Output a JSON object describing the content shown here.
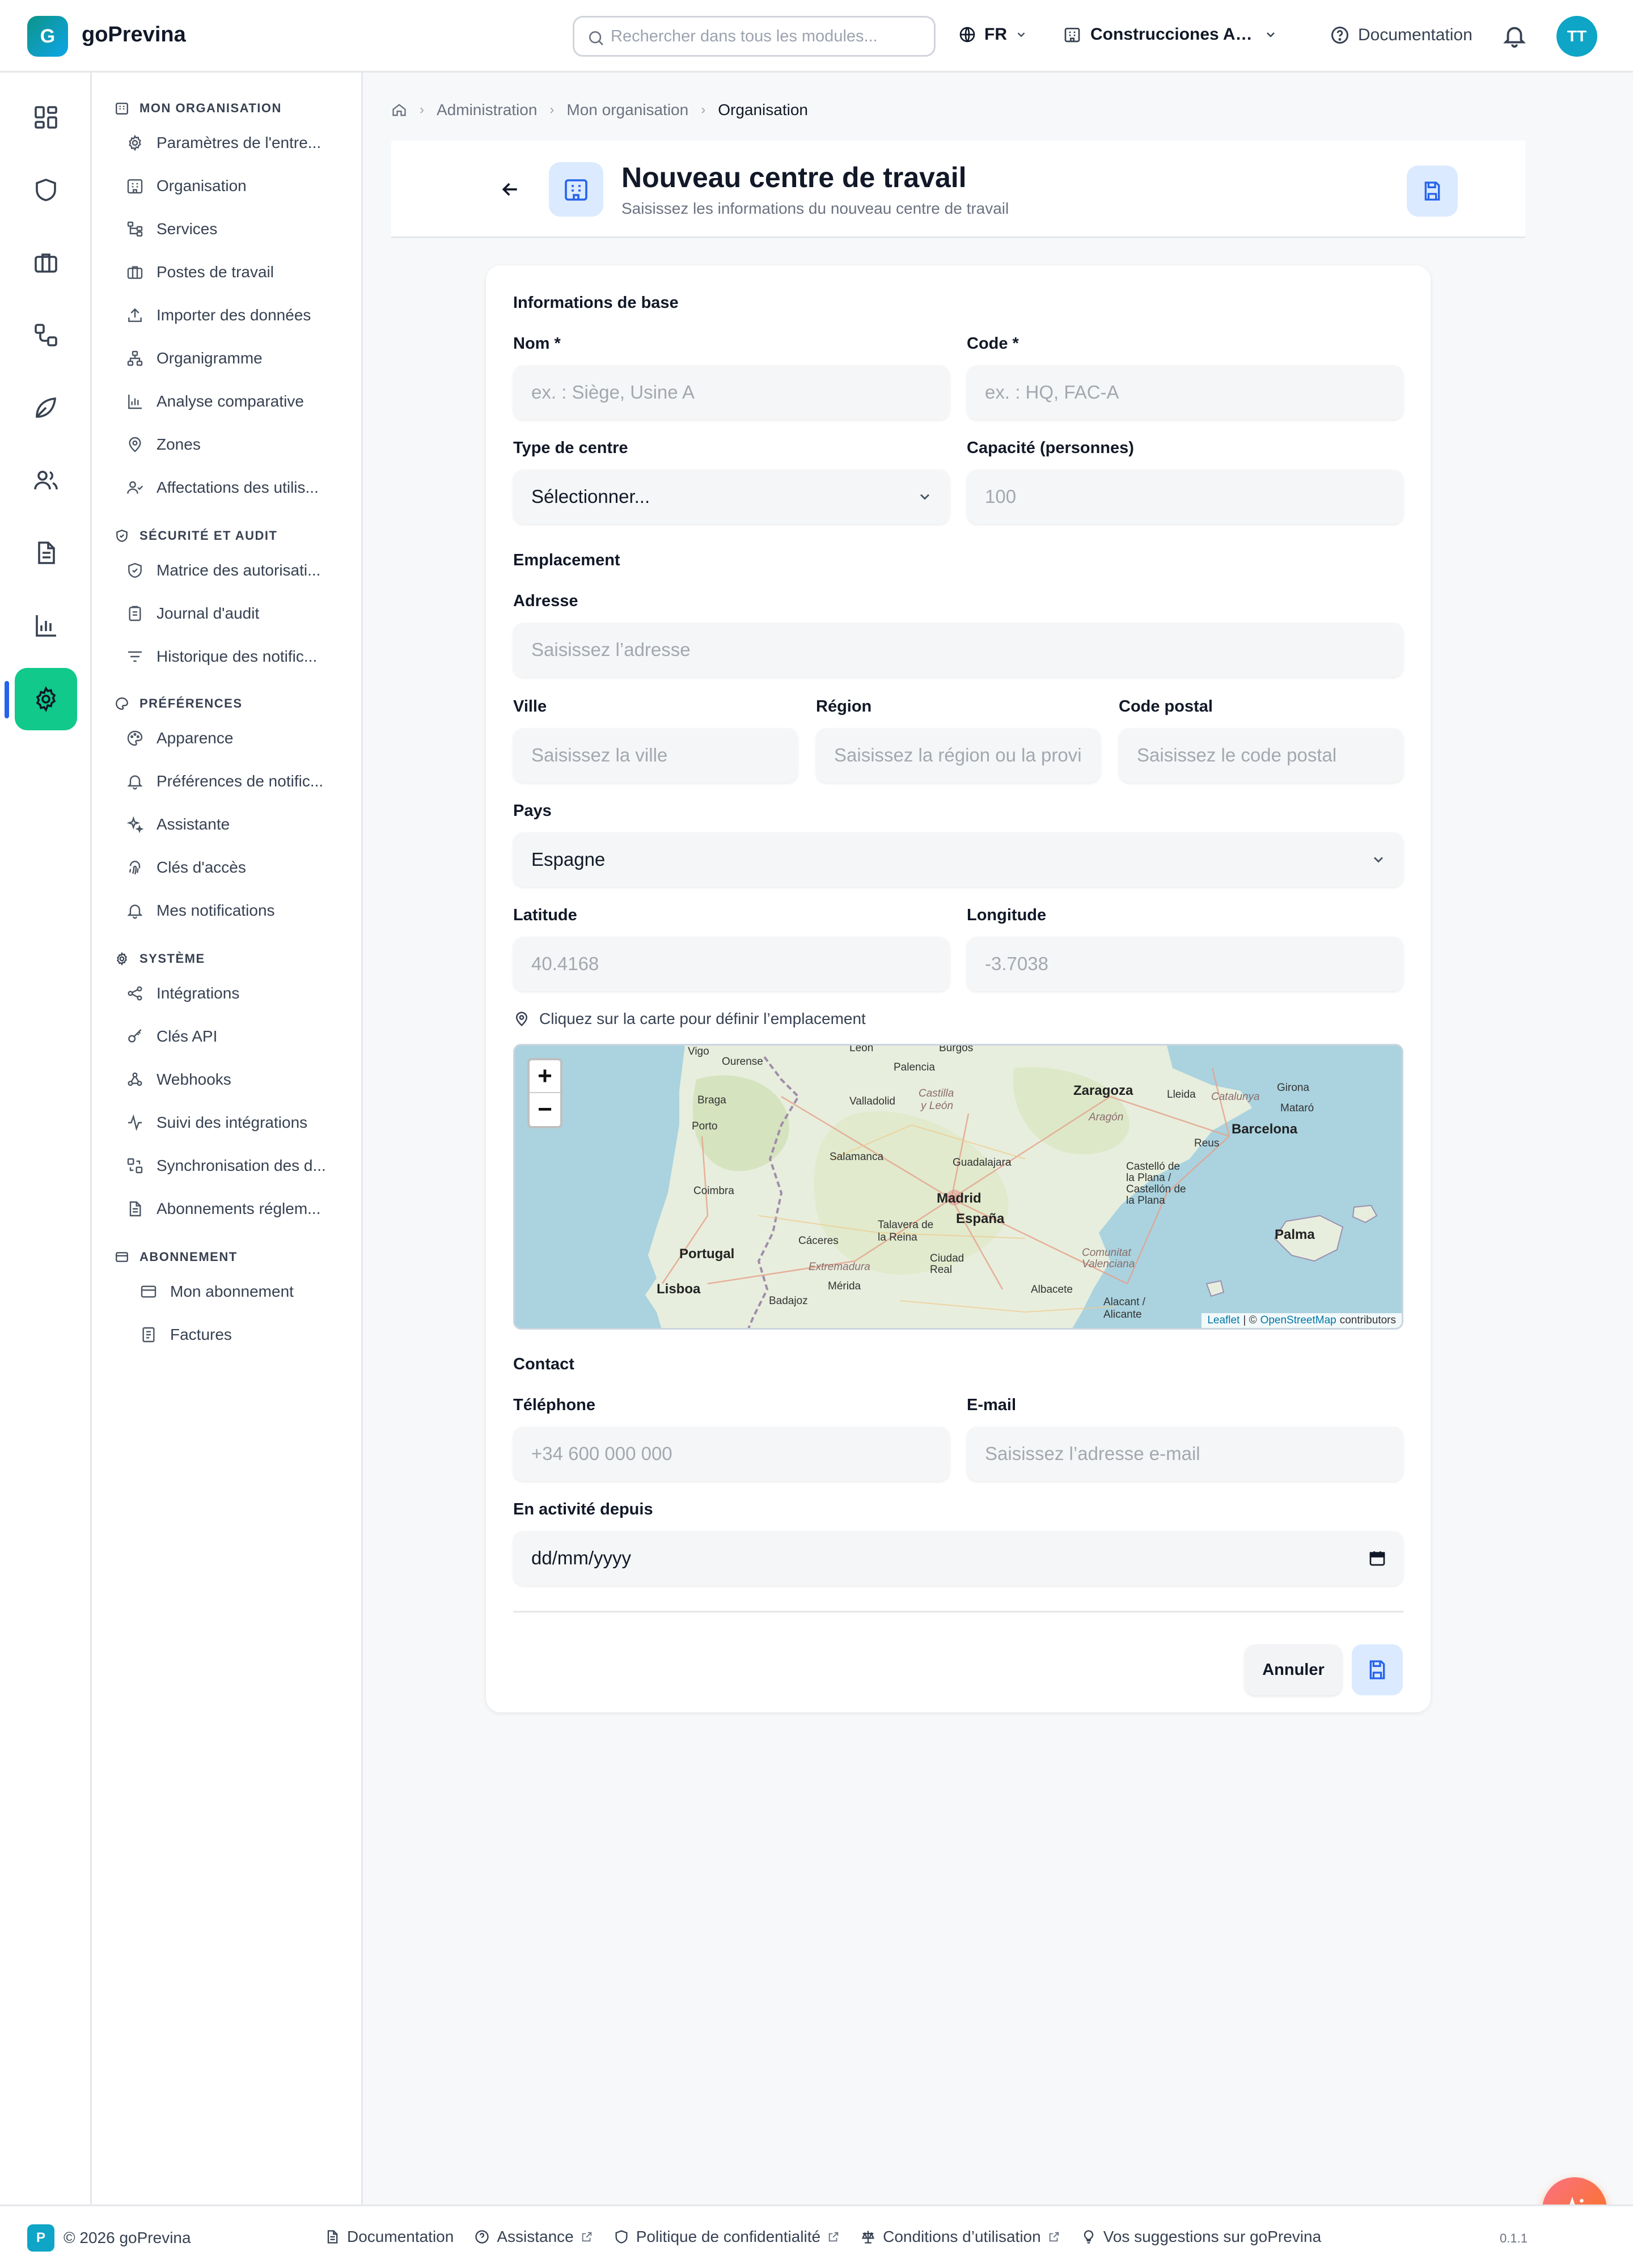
{
  "app": {
    "logo_letter": "G",
    "name": "goPrevina"
  },
  "topbar": {
    "search_placeholder": "Rechercher dans tous les modules...",
    "language": "FR",
    "tenant": "Construcciones Ac...",
    "documentation": "Documentation",
    "avatar_initials": "TT"
  },
  "rail": [
    {
      "icon": "dashboard-icon"
    },
    {
      "icon": "shield-icon"
    },
    {
      "icon": "briefcase-icon"
    },
    {
      "icon": "workflow-icon"
    },
    {
      "icon": "leaf-icon"
    },
    {
      "icon": "users-icon"
    },
    {
      "icon": "file-text-icon"
    },
    {
      "icon": "bar-chart-icon"
    },
    {
      "icon": "settings-icon",
      "active": true
    }
  ],
  "sidebar": {
    "sections": [
      {
        "title": "Mon organisation",
        "items": [
          "Paramètres de l'entre...",
          "Organisation",
          "Services",
          "Postes de travail",
          "Importer des données",
          "Organigramme",
          "Analyse comparative",
          "Zones",
          "Affectations des utilis..."
        ]
      },
      {
        "title": "Sécurité et audit",
        "items": [
          "Matrice des autorisati...",
          "Journal d'audit",
          "Historique des notific..."
        ]
      },
      {
        "title": "Préférences",
        "items": [
          "Apparence",
          "Préférences de notific...",
          "Assistante",
          "Clés d'accès",
          "Mes notifications"
        ]
      },
      {
        "title": "Système",
        "items": [
          "Intégrations",
          "Clés API",
          "Webhooks",
          "Suivi des intégrations",
          "Synchronisation des d...",
          "Abonnements réglem..."
        ]
      },
      {
        "title": "Abonnement",
        "items": [
          "Mon abonnement",
          "Factures"
        ]
      }
    ]
  },
  "breadcrumb": [
    "Administration",
    "Mon organisation",
    "Organisation"
  ],
  "header": {
    "title": "Nouveau centre de travail",
    "subtitle": "Saisissez les informations du nouveau centre de travail"
  },
  "form": {
    "basic_title": "Informations de base",
    "name_label": "Nom *",
    "name_placeholder": "ex. : Siège, Usine A",
    "code_label": "Code *",
    "code_placeholder": "ex. : HQ, FAC-A",
    "type_label": "Type de centre",
    "type_value": "Sélectionner...",
    "capacity_label": "Capacité (personnes)",
    "capacity_placeholder": "100",
    "location_title": "Emplacement",
    "address_label": "Adresse",
    "address_placeholder": "Saisissez l’adresse",
    "city_label": "Ville",
    "city_placeholder": "Saisissez la ville",
    "region_label": "Région",
    "region_placeholder": "Saisissez la région ou la province",
    "postal_label": "Code postal",
    "postal_placeholder": "Saisissez le code postal",
    "country_label": "Pays",
    "country_value": "Espagne",
    "lat_label": "Latitude",
    "lat_placeholder": "40.4168",
    "lng_label": "Longitude",
    "lng_placeholder": "-3.7038",
    "map_hint": "Cliquez sur la carte pour définir l’emplacement",
    "contact_title": "Contact",
    "phone_label": "Téléphone",
    "phone_placeholder": "+34 600 000 000",
    "email_label": "E-mail",
    "email_placeholder": "Saisissez l’adresse e-mail",
    "since_label": "En activité depuis",
    "since_placeholder": "dd/mm/yyyy",
    "cancel": "Annuler"
  },
  "map": {
    "zoom_in": "+",
    "zoom_out": "−",
    "labels": {
      "vigo": "Vigo",
      "ourense": "Ourense",
      "leon": "León",
      "burgos": "Burgos",
      "palencia": "Palencia",
      "braga": "Braga",
      "castilla": "Castilla",
      "y_leon": "y León",
      "valladolid": "Valladolid",
      "zaragoza": "Zaragoza",
      "lleida": "Lleida",
      "catalunya": "Catalunya",
      "girona": "Girona",
      "mataro": "Mataró",
      "aragon": "Aragón",
      "barcelona": "Barcelona",
      "porto": "Porto",
      "salamanca": "Salamanca",
      "reus": "Reus",
      "guadalajara": "Guadalajara",
      "castello": "Castelló de la Plana / Castellón de la Plana",
      "madrid": "Madrid",
      "coimbra": "Coimbra",
      "espana": "España",
      "talavera": "Talavera de la Reina",
      "caceres": "Cáceres",
      "portugal": "Portugal",
      "palma": "Palma",
      "comunitat": "Comunitat Valenciana",
      "ciudad_real": "Ciudad Real",
      "extremadura": "Extremadura",
      "lisboa": "Lisboa",
      "merida": "Mérida",
      "albacete": "Albacete",
      "badajoz": "Badajoz",
      "alicante": "Alacant / Alicante"
    },
    "attribution": {
      "leaflet": "Leaflet",
      "sep": "| ©",
      "osm": "OpenStreetMap",
      "contrib": "contributors"
    }
  },
  "footer": {
    "logo_letter": "P",
    "copyright": "© 2026 goPrevina",
    "links": [
      "Documentation",
      "Assistance",
      "Politique de confidentialité",
      "Conditions d’utilisation",
      "Vos suggestions sur goPrevina"
    ],
    "version": "0.1.1"
  },
  "colors": {
    "accent": "#10c98a",
    "primary": "#2563eb",
    "brand": "#0ea5c6",
    "fab": "#f97316"
  }
}
